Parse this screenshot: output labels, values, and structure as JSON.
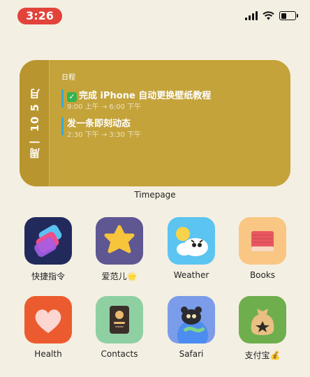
{
  "status_bar": {
    "time": "3:26"
  },
  "widget": {
    "date_vertical": "周一 10 5 月",
    "section_label": "日程",
    "events": [
      {
        "title": "完成 iPhone 自动更换壁纸教程",
        "time": "9:00 上午 → 6:00 下午",
        "completed": true
      },
      {
        "title": "发一条即刻动态",
        "time": "2:30 下午 → 3:30 下午",
        "completed": false
      }
    ],
    "name": "Timepage"
  },
  "apps": [
    {
      "label": "快捷指令",
      "icon": "shortcuts-icon"
    },
    {
      "label": "爱范儿🌟",
      "icon": "ifanr-icon"
    },
    {
      "label": "Weather",
      "icon": "weather-icon"
    },
    {
      "label": "Books",
      "icon": "books-icon"
    },
    {
      "label": "Health",
      "icon": "health-icon"
    },
    {
      "label": "Contacts",
      "icon": "contacts-icon"
    },
    {
      "label": "Safari",
      "icon": "safari-icon"
    },
    {
      "label": "支付宝💰",
      "icon": "alipay-icon"
    }
  ],
  "colors": {
    "background": "#f4efe3",
    "widget": "#c4a33a",
    "time_pill": "#e2433b",
    "event_bar": "#3aa7d8"
  }
}
